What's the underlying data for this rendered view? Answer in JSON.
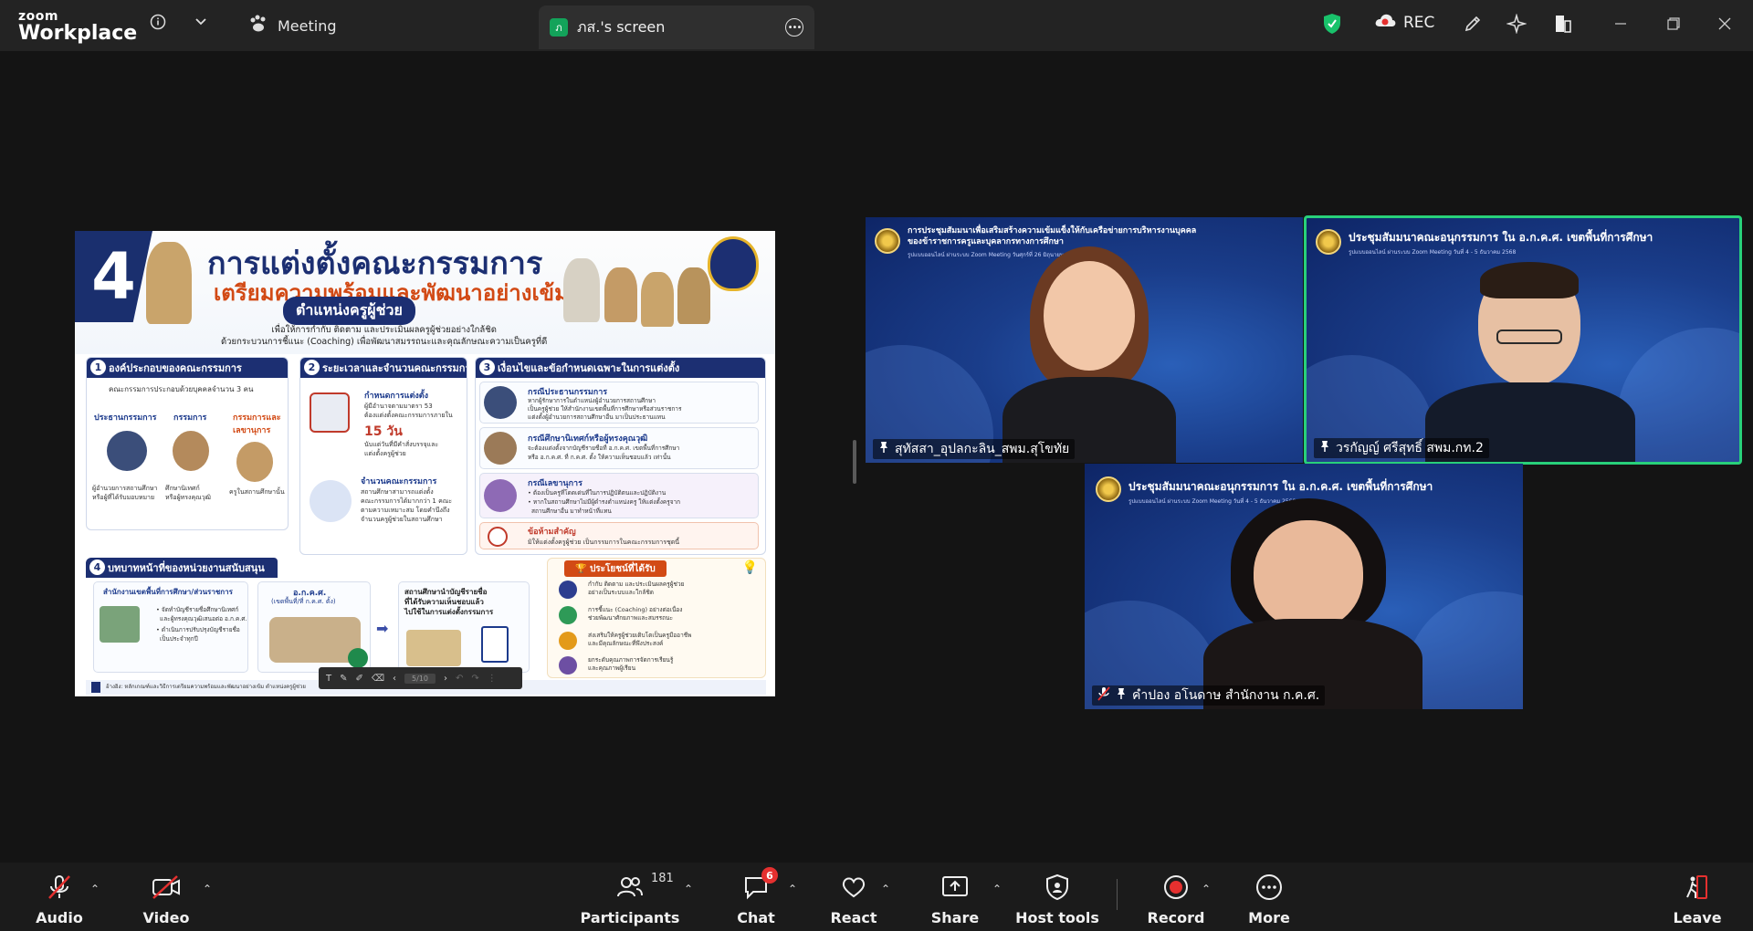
{
  "titlebar": {
    "logo_line1": "zoom",
    "logo_line2": "Workplace",
    "meeting_label": "Meeting",
    "screen_tab_avatar": "ภ",
    "screen_tab_label": "ภส.'s screen",
    "rec_label": "REC",
    "shield_color": "#19c26b",
    "icons": [
      "info-icon",
      "chevron-down-icon",
      "paw-icon",
      "more-icon",
      "shield-icon",
      "cloud-record-icon",
      "pen-icon",
      "sparkle-icon",
      "panel-icon",
      "minimize-icon",
      "restore-icon",
      "close-icon"
    ]
  },
  "slide": {
    "number": "4",
    "title1": "การแต่งตั้งคณะกรรมการ",
    "title2": "เตรียมความพร้อมและพัฒนาอย่างเข้ม",
    "title3": "ตำแหน่งครูผู้ช่วย",
    "subtitle1": "เพื่อให้การกำกับ ติดตาม และประเมินผลครูผู้ช่วยอย่างใกล้ชิด",
    "subtitle2": "ด้วยกระบวนการชี้แนะ (Coaching) เพื่อพัฒนาสมรรถนะและคุณลักษณะความเป็นครูที่ดี",
    "panel1": {
      "number": "1",
      "title": "องค์ประกอบของคณะกรรมการ",
      "intro": "คณะกรรมการประกอบด้วยบุคคลจำนวน 3 คน",
      "roles": [
        {
          "name": "ประธานกรรมการ",
          "desc1": "ผู้อำนวยการสถานศึกษา",
          "desc2": "หรือผู้ที่ได้รับมอบหมาย"
        },
        {
          "name": "กรรมการ",
          "desc1": "ศึกษานิเทศก์",
          "desc2": "หรือผู้ทรงคุณวุฒิ"
        },
        {
          "name": "กรรมการและเลขานุการ",
          "desc1": "ครูในสถานศึกษานั้น",
          "desc2": ""
        }
      ]
    },
    "panel2": {
      "number": "2",
      "title": "ระยะเวลาและจำนวนคณะกรรมการ",
      "h1": "กำหนดการแต่งตั้ง",
      "t1a": "ผู้มีอำนาจตามมาตรา 53",
      "t1b": "ต้องแต่งตั้งคณะกรรมการภายใน",
      "days": "15 วัน",
      "t1c": "นับแต่วันที่มีคำสั่งบรรจุและ",
      "t1d": "แต่งตั้งครูผู้ช่วย",
      "h2": "จำนวนคณะกรรมการ",
      "t2a": "สถานศึกษาสามารถแต่งตั้ง",
      "t2b": "คณะกรรมการได้มากกว่า 1 คณะ",
      "t2c": "ตามความเหมาะสม โดยคำนึงถึง",
      "t2d": "จำนวนครูผู้ช่วยในสถานศึกษา"
    },
    "panel3": {
      "number": "3",
      "title": "เงื่อนไขและข้อกำหนดเฉพาะในการแต่งตั้ง",
      "items": [
        {
          "head": "กรณีประธานกรรมการ",
          "l1": "หากผู้รักษาการในตำแหน่งผู้อำนวยการสถานศึกษา",
          "l2": "เป็นครูผู้ช่วย ให้สำนักงานเขตพื้นที่การศึกษาหรือส่วนราชการ",
          "l3": "แต่งตั้งผู้อำนวยการสถานศึกษาอื่น มาเป็นประธานแทน"
        },
        {
          "head": "กรณีศึกษานิเทศก์หรือผู้ทรงคุณวุฒิ",
          "l1": "จะต้องแต่งตั้งจากบัญชีรายชื่อที่ อ.ก.ค.ศ. เขตพื้นที่การศึกษา",
          "l2": "หรือ อ.ก.ค.ศ. ที่ ก.ค.ศ. ตั้ง ให้ความเห็นชอบแล้ว เท่านั้น",
          "l3": ""
        },
        {
          "head": "กรณีเลขานุการ",
          "l1": "• ต้องเป็นครูที่โดดเด่นที่ในการปฏิบัติตนและปฏิบัติงาน",
          "l2": "• หากในสถานศึกษาไม่มีผู้ดำรงตำแหน่งครู ให้แต่งตั้งครูจาก",
          "l3": "สถานศึกษาอื่น มาทำหน้าที่แทน"
        }
      ],
      "warn_head": "ข้อห้ามสำคัญ",
      "warn_text": "มิให้แต่งตั้งครูผู้ช่วย เป็นกรรมการในคณะกรรมการชุดนี้"
    },
    "panel4": {
      "number": "4",
      "title": "บทบาทหน้าที่ของหน่วยงานสนับสนุน",
      "box1_title": "สำนักงานเขตพื้นที่การศึกษา/ส่วนราชการ",
      "box1_l1": "• จัดทำบัญชีรายชื่อศึกษานิเทศก์",
      "box1_l2": "และผู้ทรงคุณวุฒิเสนอต่อ อ.ก.ค.ศ.",
      "box1_l3": "• ดำเนินการปรับปรุงบัญชีรายชื่อ",
      "box1_l4": "เป็นประจำทุกปี",
      "box2_title": "อ.ก.ค.ศ.",
      "box2_sub": "(เขตพื้นที่/ที่ ก.ค.ศ. ตั้ง)",
      "box3_l1": "สถานศึกษานำบัญชีรายชื่อ",
      "box3_l2": "ที่ได้รับความเห็นชอบแล้ว",
      "box3_l3": "ไปใช้ในการแต่งตั้งกรรมการ"
    },
    "benefits": {
      "title": "ประโยชน์ที่ได้รับ",
      "items": [
        {
          "l1": "กำกับ ติดตาม และประเมินผลครูผู้ช่วย",
          "l2": "อย่างเป็นระบบและใกล้ชิด"
        },
        {
          "l1": "การชี้แนะ (Coaching) อย่างต่อเนื่อง",
          "l2": "ช่วยพัฒนาศักยภาพและสมรรถนะ"
        },
        {
          "l1": "ส่งเสริมให้ครูผู้ช่วยเติบโตเป็นครูมืออาชีพ",
          "l2": "และมีคุณลักษณะที่พึงประสงค์"
        },
        {
          "l1": "ยกระดับคุณภาพการจัดการเรียนรู้",
          "l2": "และคุณภาพผู้เรียน"
        }
      ]
    },
    "source_note": "อ้างอิง: หลักเกณฑ์และวิธีการเตรียมความพร้อมและพัฒนาอย่างเข้ม ตำแหน่งครูผู้ช่วย",
    "annot_toolbar": {
      "page_indicator": "5/10"
    }
  },
  "participants": [
    {
      "name": "สุทัสสา_อุปลกะลิน_สพม.สุโขทัย",
      "banner1": "การประชุมสัมมนาเพื่อเสริมสร้างความเข้มแข็งให้กับเครือข่ายการบริหารงานบุคคล",
      "banner2": "ของข้าราชการครูและบุคลากรทางการศึกษา",
      "banner3": "รูปแบบออนไลน์ ผ่านระบบ Zoom Meeting วันศุกร์ที่ 26 มิถุนายน"
    },
    {
      "name": "วรกัญญ์ ศรีสุทธิ์ สพม.กท.2",
      "banner1": "ประชุมสัมมนาคณะอนุกรรมการ ใน อ.ก.ค.ศ. เขตพื้นที่การศึกษา",
      "banner2": "รูปแบบออนไลน์ ผ่านระบบ Zoom Meeting วันที่ 4 - 5 ธันวาคม 2568"
    },
    {
      "name": "คำปอง อโนดาษ สำนักงาน ก.ค.ศ.",
      "banner1": "ประชุมสัมมนาคณะอนุกรรมการ ใน อ.ก.ค.ศ. เขตพื้นที่การศึกษา",
      "banner2": "รูปแบบออนไลน์ ผ่านระบบ Zoom Meeting วันที่ 4 - 5 ธันวาคม 2568"
    }
  ],
  "bottombar": {
    "audio": "Audio",
    "video": "Video",
    "participants": "Participants",
    "participant_count": "181",
    "chat": "Chat",
    "chat_badge": "6",
    "react": "React",
    "share": "Share",
    "host_tools": "Host tools",
    "record": "Record",
    "more": "More",
    "leave": "Leave",
    "record_color": "#e5302f",
    "leave_color": "#e5302f"
  }
}
